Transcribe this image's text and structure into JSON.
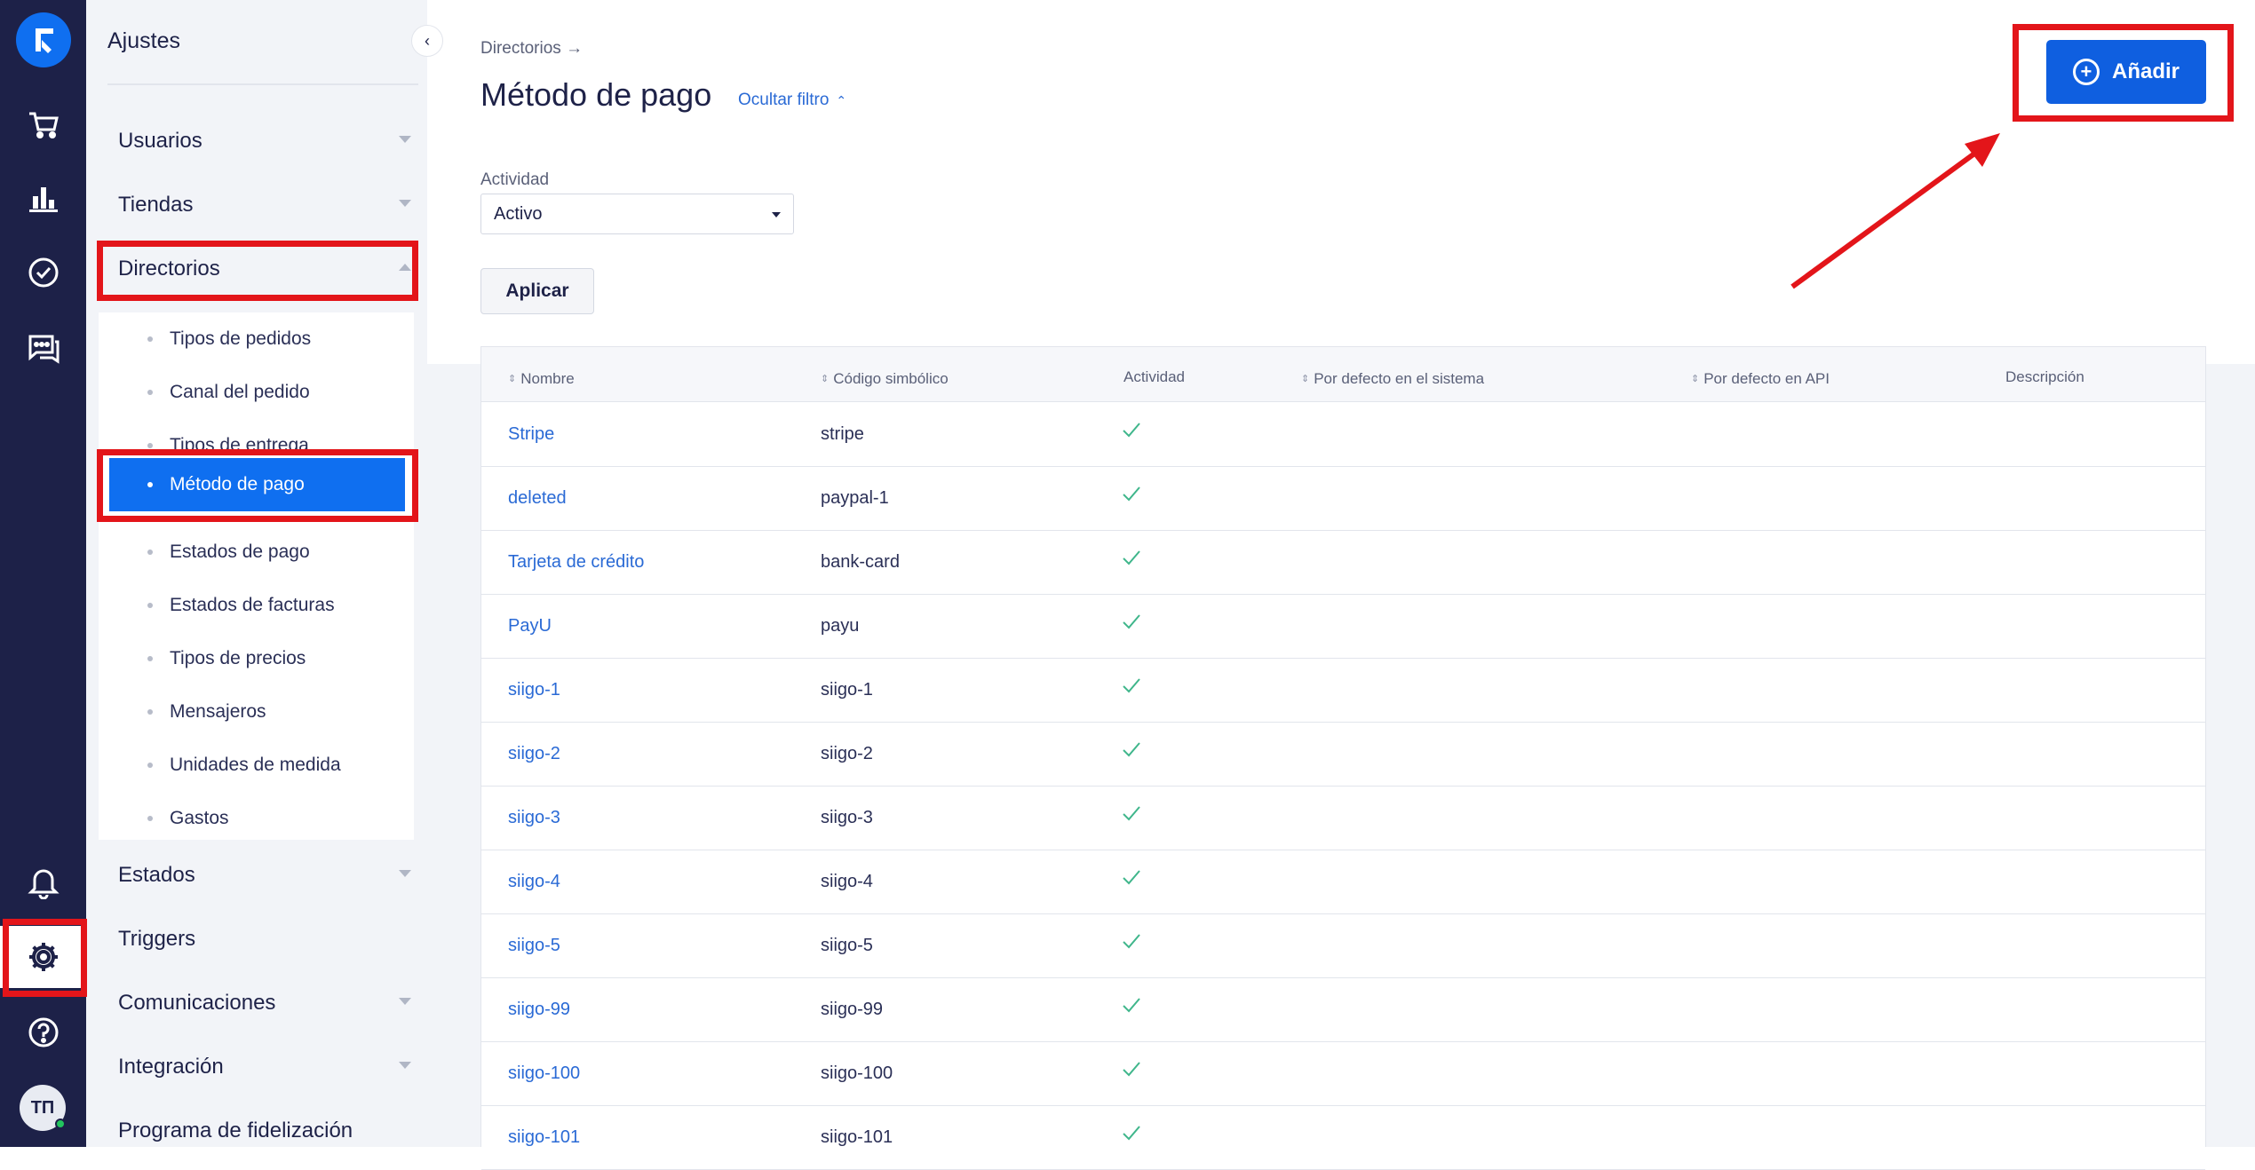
{
  "rail": {
    "logo_icon": "brand-logo-icon",
    "icons": [
      "cart-icon",
      "analytics-icon",
      "tasks-check-icon",
      "chat-icon",
      "bell-icon",
      "gear-icon",
      "help-icon"
    ],
    "avatar_initials": "ТП"
  },
  "sidebar": {
    "title": "Ajustes",
    "groups": [
      {
        "label": "Usuarios"
      },
      {
        "label": "Tiendas"
      },
      {
        "label": "Directorios"
      },
      {
        "label": "Estados"
      },
      {
        "label": "Triggers"
      },
      {
        "label": "Comunicaciones"
      },
      {
        "label": "Integración"
      },
      {
        "label": "Programa de fidelización"
      }
    ],
    "subitems": [
      {
        "label": "Tipos de pedidos"
      },
      {
        "label": "Canal del pedido"
      },
      {
        "label": "Tipos de entrega"
      },
      {
        "label": "Método de pago"
      },
      {
        "label": "Estados de pago"
      },
      {
        "label": "Estados de facturas"
      },
      {
        "label": "Tipos de precios"
      },
      {
        "label": "Mensajeros"
      },
      {
        "label": "Unidades de medida"
      },
      {
        "label": "Gastos"
      }
    ]
  },
  "main": {
    "breadcrumb": "Directorios →",
    "title": "Método de pago",
    "filter_toggle": "Ocultar filtro",
    "filter_label": "Actividad",
    "filter_value": "Activo",
    "apply_label": "Aplicar",
    "add_label": "Añadir"
  },
  "table": {
    "columns": [
      "Nombre",
      "Código simbólico",
      "Actividad",
      "Por defecto en el sistema",
      "Por defecto en API",
      "Descripción"
    ],
    "rows": [
      {
        "name": "Stripe",
        "code": "stripe",
        "active": true
      },
      {
        "name": "deleted",
        "code": "paypal-1",
        "active": true
      },
      {
        "name": "Tarjeta de crédito",
        "code": "bank-card",
        "active": true
      },
      {
        "name": "PayU",
        "code": "payu",
        "active": true
      },
      {
        "name": "siigo-1",
        "code": "siigo-1",
        "active": true
      },
      {
        "name": "siigo-2",
        "code": "siigo-2",
        "active": true
      },
      {
        "name": "siigo-3",
        "code": "siigo-3",
        "active": true
      },
      {
        "name": "siigo-4",
        "code": "siigo-4",
        "active": true
      },
      {
        "name": "siigo-5",
        "code": "siigo-5",
        "active": true
      },
      {
        "name": "siigo-99",
        "code": "siigo-99",
        "active": true
      },
      {
        "name": "siigo-100",
        "code": "siigo-100",
        "active": true
      },
      {
        "name": "siigo-101",
        "code": "siigo-101",
        "active": true
      }
    ]
  },
  "colors": {
    "rail": "#1d2148",
    "accent": "#0f6ff0",
    "annotation": "#e3151a",
    "check": "#3fb68b"
  }
}
